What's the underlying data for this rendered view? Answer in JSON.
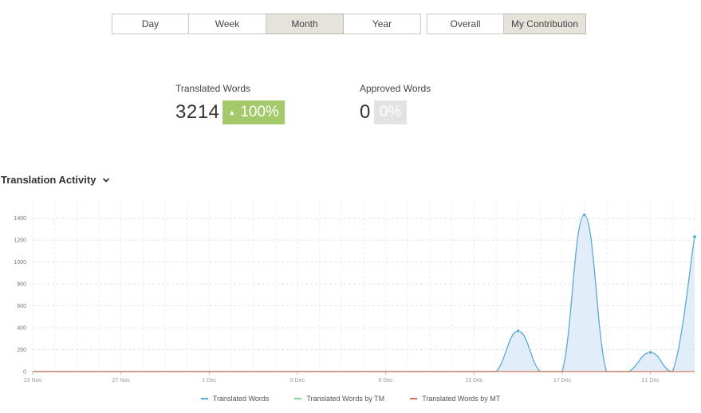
{
  "period_buttons": [
    {
      "label": "Day",
      "active": false
    },
    {
      "label": "Week",
      "active": false
    },
    {
      "label": "Month",
      "active": true
    },
    {
      "label": "Year",
      "active": false
    }
  ],
  "scope_buttons": [
    {
      "label": "Overall",
      "active": false
    },
    {
      "label": "My Contribution",
      "active": true
    }
  ],
  "stats": {
    "translated": {
      "label": "Translated Words",
      "value": "3214",
      "badge": "100%",
      "badge_arrow": "▲"
    },
    "approved": {
      "label": "Approved Words",
      "value": "0",
      "badge": "0%"
    }
  },
  "section": {
    "title": "Translation Activity",
    "icon": "chevron-down-icon"
  },
  "colors": {
    "translated": "#5aa9d6",
    "tm": "#8fd19e",
    "mt": "#e0704f",
    "area": "#d9e9f6"
  },
  "chart_data": {
    "type": "area",
    "x_ticks": [
      "23 Nov",
      "27 Nov",
      "1 Dec",
      "5 Dec",
      "9 Dec",
      "13 Dec",
      "17 Dec",
      "21 Dec"
    ],
    "y_ticks": [
      "0",
      "200",
      "400",
      "600",
      "800",
      "1000",
      "1200",
      "1400"
    ],
    "ylim": [
      0,
      1500
    ],
    "x_start": "23 Nov",
    "days": 30,
    "series": [
      {
        "name": "Translated Words",
        "values": [
          0,
          0,
          0,
          0,
          0,
          0,
          0,
          0,
          0,
          0,
          0,
          0,
          0,
          0,
          0,
          0,
          0,
          0,
          0,
          0,
          0,
          0,
          370,
          0,
          0,
          1430,
          0,
          0,
          175,
          0,
          1230
        ]
      },
      {
        "name": "Translated Words by TM",
        "values": [
          0,
          0,
          0,
          0,
          0,
          0,
          0,
          0,
          0,
          0,
          0,
          0,
          0,
          0,
          0,
          0,
          0,
          0,
          0,
          0,
          0,
          0,
          0,
          0,
          0,
          0,
          0,
          0,
          0,
          0,
          0
        ]
      },
      {
        "name": "Translated Words by MT",
        "values": [
          0,
          0,
          0,
          0,
          0,
          0,
          0,
          0,
          0,
          0,
          0,
          0,
          0,
          0,
          0,
          0,
          0,
          0,
          0,
          0,
          0,
          0,
          0,
          0,
          0,
          0,
          0,
          0,
          0,
          0,
          0
        ]
      }
    ]
  }
}
